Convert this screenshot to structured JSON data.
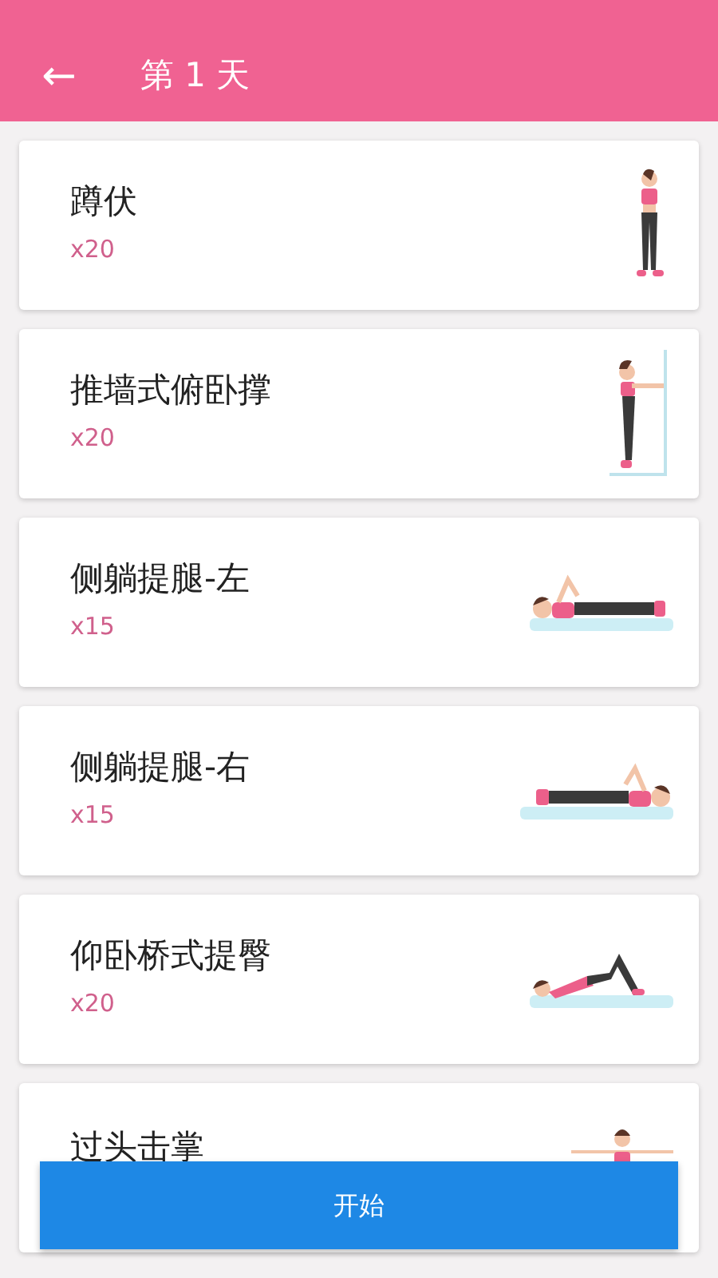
{
  "header": {
    "back_icon": "←",
    "title": "第 1 天"
  },
  "exercises": [
    {
      "name": "蹲伏",
      "count": "x20",
      "kind": "standing"
    },
    {
      "name": "推墙式俯卧撑",
      "count": "x20",
      "kind": "wall"
    },
    {
      "name": "侧躺提腿-左",
      "count": "x15",
      "kind": "lying-left"
    },
    {
      "name": "侧躺提腿-右",
      "count": "x15",
      "kind": "lying-right"
    },
    {
      "name": "仰卧桥式提臀",
      "count": "x20",
      "kind": "bridge"
    },
    {
      "name": "过头击掌",
      "kind": "arms-out"
    }
  ],
  "start_button": "开始"
}
